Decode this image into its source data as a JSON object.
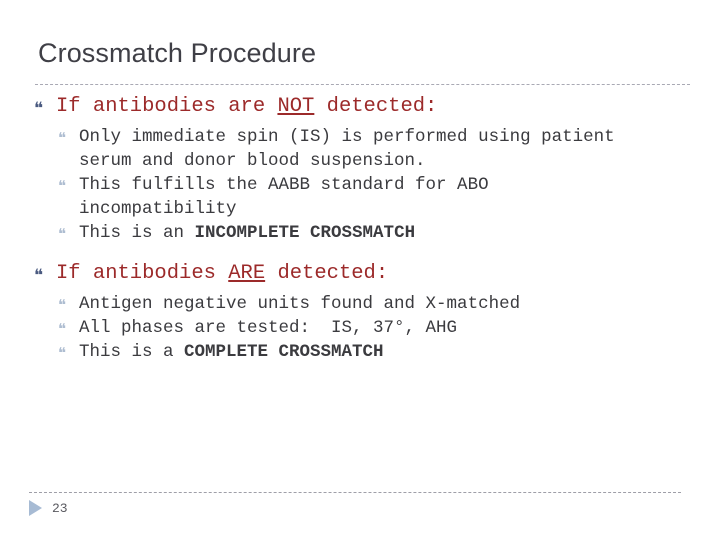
{
  "slide": {
    "title": "Crossmatch Procedure",
    "page_number": "23",
    "colors": {
      "title_text": "#3f3f46",
      "level1_text": "#9c2a2a",
      "level2_text": "#3b3b3f",
      "level1_bullet": "#4a5a80",
      "level2_bullet": "#aebdd1",
      "rule": "#a9a9b4",
      "footer_arrow": "#a7bbd4",
      "background": "#ffffff"
    },
    "bullet_glyphs": {
      "level1": "❝",
      "level2": "❝"
    },
    "blocks": [
      {
        "heading": {
          "before": "If antibodies are ",
          "underlined": "NOT",
          "after": " detected:"
        },
        "items": [
          {
            "parts": [
              {
                "text": "Only immediate spin (IS) is performed using patient serum and donor blood suspension.",
                "style": "normal"
              }
            ]
          },
          {
            "parts": [
              {
                "text": "This fulfills the AABB standard for ABO incompatibility",
                "style": "normal"
              }
            ]
          },
          {
            "parts": [
              {
                "text": "This is an ",
                "style": "normal"
              },
              {
                "text": "INCOMPLETE CROSSMATCH",
                "style": "bold"
              }
            ]
          }
        ]
      },
      {
        "heading": {
          "before": "If antibodies ",
          "underlined": "ARE",
          "after": " detected:"
        },
        "items": [
          {
            "parts": [
              {
                "text": "Antigen negative units found and X-matched",
                "style": "normal"
              }
            ]
          },
          {
            "parts": [
              {
                "text": "All phases are tested:  IS, 37°, AHG",
                "style": "normal"
              }
            ]
          },
          {
            "parts": [
              {
                "text": "This is a ",
                "style": "normal"
              },
              {
                "text": "COMPLETE CROSSMATCH",
                "style": "bold"
              }
            ]
          }
        ]
      }
    ]
  }
}
